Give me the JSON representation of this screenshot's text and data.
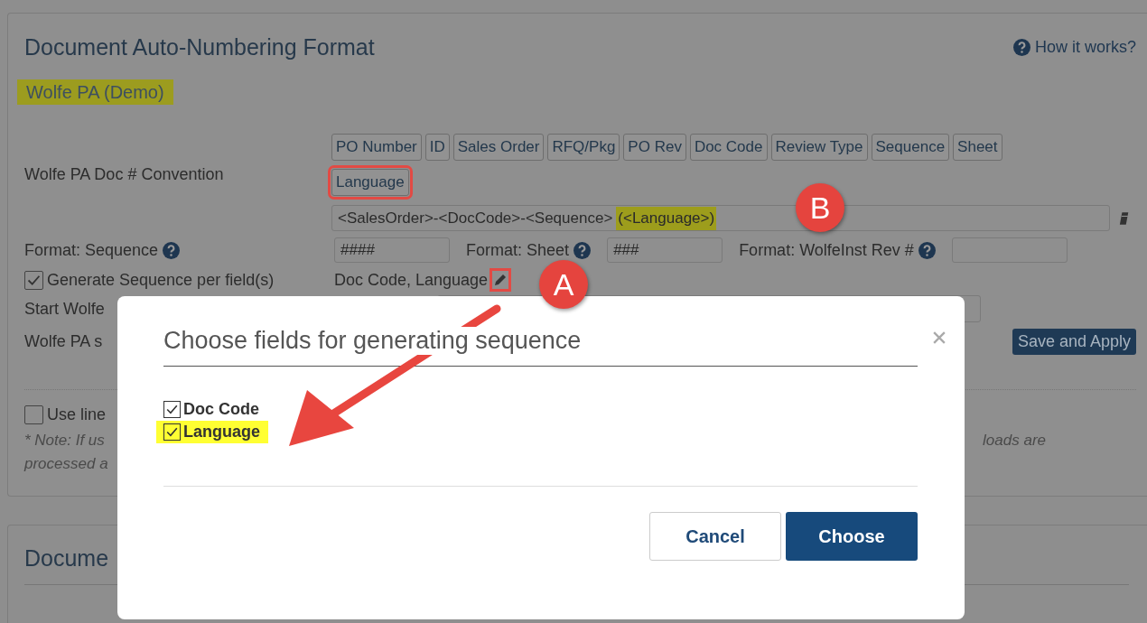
{
  "page": {
    "title": "Document Auto-Numbering Format",
    "help_link": "How it works?",
    "company": "Wolfe PA (Demo)",
    "convention": {
      "label": "Wolfe PA Doc # Convention",
      "tokens": [
        {
          "label": "PO Number",
          "framed": false
        },
        {
          "label": "ID",
          "framed": false
        },
        {
          "label": "Sales Order",
          "framed": false
        },
        {
          "label": "RFQ/Pkg",
          "framed": false
        },
        {
          "label": "PO Rev",
          "framed": false
        },
        {
          "label": "Doc Code",
          "framed": false
        },
        {
          "label": "Review Type",
          "framed": false
        },
        {
          "label": "Sequence",
          "framed": false
        },
        {
          "label": "Sheet",
          "framed": false
        },
        {
          "label": "Language",
          "framed": true
        }
      ],
      "value": "<SalesOrder>-<DocCode>-<Sequence>",
      "highlighted_suffix": "(<Language>)"
    },
    "formats": [
      {
        "label": "Format: Sequence",
        "value": "####"
      },
      {
        "label": "Format: Sheet",
        "value": "###"
      },
      {
        "label": "Format: WolfeInst Rev #"
      }
    ],
    "generate_per_field": {
      "label": "Generate Sequence per field(s)",
      "checked": true,
      "fields_text": "Doc Code, Language",
      "edit_framed": true
    },
    "start_label": "Start Wolfe",
    "settings_label": "Wolfe PA s",
    "save_button": "Save and Apply",
    "use_line": {
      "label": "Use line",
      "checked": false
    },
    "note_lines": [
      "* Note: If us",
      "processed a"
    ],
    "note_tail": "loads are",
    "second_card_title": "Docume"
  },
  "dialog": {
    "title": "Choose fields for generating sequence",
    "options": [
      {
        "label": "Doc Code",
        "checked": true,
        "highlighted": false
      },
      {
        "label": "Language",
        "checked": true,
        "highlighted": true
      }
    ],
    "buttons": [
      {
        "label": "Cancel",
        "kind": "secondary"
      },
      {
        "label": "Choose",
        "kind": "primary"
      }
    ]
  },
  "callouts": [
    {
      "label": "A"
    },
    {
      "label": "B"
    }
  ]
}
